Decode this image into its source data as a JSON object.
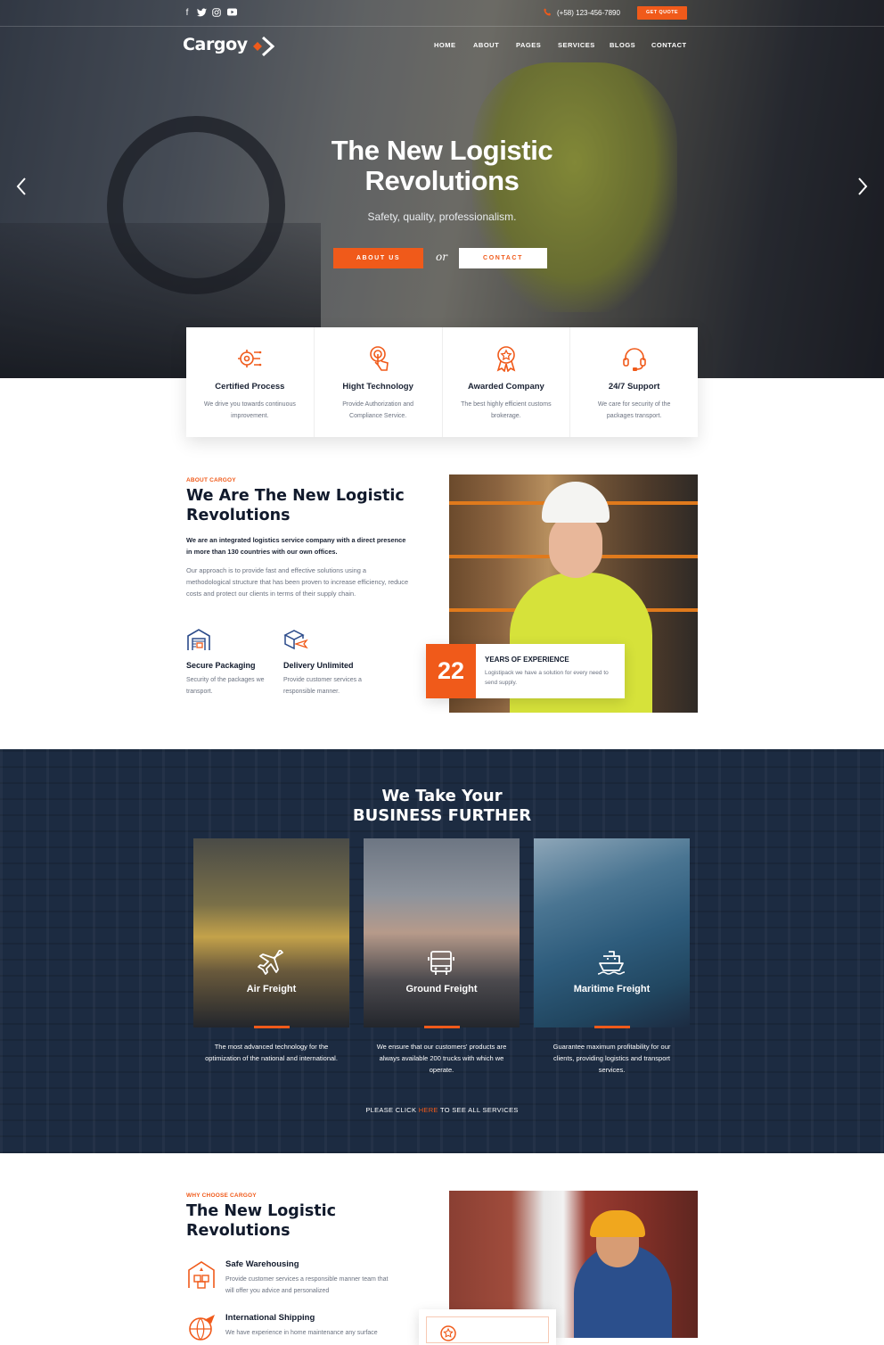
{
  "topbar": {
    "social": [
      "f",
      "t",
      "in",
      "yt"
    ],
    "phone": "(+58) 123-456-7890",
    "quote_label": "GET QUOTE"
  },
  "header": {
    "logo": "Cargoy",
    "nav": [
      "HOME",
      "ABOUT",
      "PAGES",
      "SERVICES",
      "BLOGS",
      "CONTACT"
    ]
  },
  "hero": {
    "title": "The New Logistic Revolutions",
    "subtitle": "Safety, quality, professionalism.",
    "btn_about": "ABOUT US",
    "or": "or",
    "btn_contact": "CONTACT"
  },
  "features": [
    {
      "icon": "gear-circuit-icon",
      "title": "Certified Process",
      "desc": "We drive you towards continuous improvement."
    },
    {
      "icon": "touch-tech-icon",
      "title": "Hight Technology",
      "desc": "Provide Authorization and Compliance Service."
    },
    {
      "icon": "award-ribbon-icon",
      "title": "Awarded Company",
      "desc": "The best highly efficient customs brokerage."
    },
    {
      "icon": "headset-icon",
      "title": "24/7 Support",
      "desc": "We care for security of the packages transport."
    }
  ],
  "about": {
    "tag": "ABOUT CARGOY",
    "title": "We Are The New Logistic Revolutions",
    "lead": "We are an integrated logistics service company with a direct presence in more than 130 countries with our own offices.",
    "body": "Our approach is to provide fast and effective solutions using a methodological structure that has been proven to increase efficiency, reduce costs and protect our clients in terms of their supply chain.",
    "items": [
      {
        "icon": "warehouse-icon",
        "title": "Secure Packaging",
        "desc": "Security of the packages we transport."
      },
      {
        "icon": "box-plane-icon",
        "title": "Delivery Unlimited",
        "desc": "Provide customer services a responsible manner."
      }
    ],
    "experience": {
      "number": "22",
      "title": "YEARS OF EXPERIENCE",
      "desc": "Logistipack we have a solution for every need to send supply."
    }
  },
  "services": {
    "title_line1": "We Take Your",
    "title_line2": "BUSINESS FURTHER",
    "cards": [
      {
        "icon": "airplane-icon",
        "title": "Air Freight",
        "desc": "The most advanced technology for the optimization of the national and international."
      },
      {
        "icon": "truck-icon",
        "title": "Ground Freight",
        "desc": "We ensure that our customers' products are always available 200 trucks with which we operate."
      },
      {
        "icon": "ship-icon",
        "title": "Maritime Freight",
        "desc": "Guarantee maximum profitability for our clients, providing logistics and transport services."
      }
    ],
    "click_pre": "PLEASE CLICK",
    "click_link": "HERE",
    "click_post": "TO SEE ALL SERVICES"
  },
  "why": {
    "tag": "WHY CHOOSE CARGOY",
    "title": "The New Logistic Revolutions",
    "items": [
      {
        "icon": "warehouse-boxes-icon",
        "title": "Safe Warehousing",
        "desc": "Provide customer services a responsible manner team that will offer you advice and personalized"
      },
      {
        "icon": "globe-plane-icon",
        "title": "International Shipping",
        "desc": "We have experience in home maintenance any surface"
      }
    ]
  },
  "colors": {
    "accent": "#f05a1a",
    "navy": "#1c2b41",
    "text": "#111a2c"
  }
}
